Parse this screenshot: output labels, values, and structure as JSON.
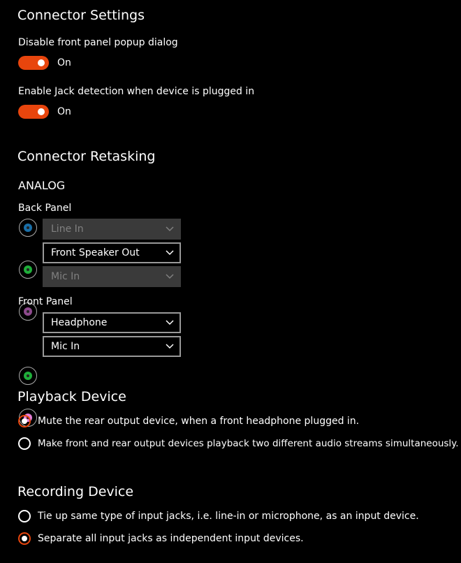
{
  "connector_settings": {
    "title": "Connector Settings",
    "disable_popup": {
      "label": "Disable front panel popup dialog",
      "state": "On"
    },
    "jack_detection": {
      "label": "Enable Jack detection when device is plugged in",
      "state": "On"
    }
  },
  "retasking": {
    "title": "Connector Retasking",
    "section": "ANALOG",
    "back_panel": {
      "label": "Back Panel",
      "jacks": [
        {
          "value": "Line In",
          "color": "#1a6fa8",
          "enabled": false
        },
        {
          "value": "Front Speaker Out",
          "color": "#1fae3a",
          "enabled": true
        },
        {
          "value": "Mic In",
          "color": "#8e4a8e",
          "enabled": false
        }
      ]
    },
    "front_panel": {
      "label": "Front Panel",
      "jacks": [
        {
          "value": "Headphone",
          "color": "#1fae3a",
          "enabled": true
        },
        {
          "value": "Mic In",
          "color": "#e37fd7",
          "enabled": true
        }
      ]
    }
  },
  "playback": {
    "title": "Playback Device",
    "options": [
      {
        "label": "Mute the rear output device, when a front headphone plugged in.",
        "checked": true
      },
      {
        "label": "Make front and rear output devices playback two different audio streams simultaneously.",
        "checked": false
      }
    ]
  },
  "recording": {
    "title": "Recording Device",
    "options": [
      {
        "label": "Tie up same type of input jacks, i.e. line-in or microphone, as an input device.",
        "checked": false
      },
      {
        "label": "Separate all input jacks as independent input devices.",
        "checked": true
      }
    ]
  },
  "colors": {
    "accent": "#e8450d",
    "background": "#000000"
  }
}
